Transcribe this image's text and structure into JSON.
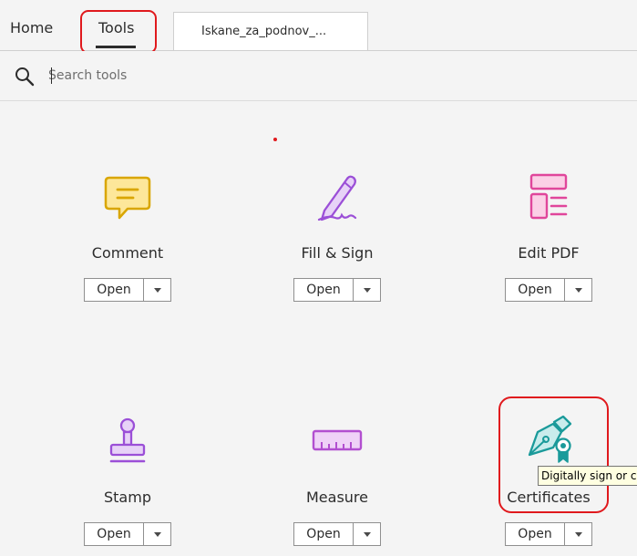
{
  "tabs": {
    "home": "Home",
    "tools": "Tools",
    "document": "Iskane_za_podnov_..."
  },
  "search": {
    "placeholder": "Search tools"
  },
  "tools": [
    {
      "name": "Comment",
      "open": "Open",
      "icon": "comment-icon",
      "color": "#d9a600"
    },
    {
      "name": "Fill & Sign",
      "open": "Open",
      "icon": "fill-sign-icon",
      "color": "#9b4fd7"
    },
    {
      "name": "Edit PDF",
      "open": "Open",
      "icon": "edit-pdf-icon",
      "color": "#e0469b"
    },
    {
      "name": "Stamp",
      "open": "Open",
      "icon": "stamp-icon",
      "color": "#9b4fd7"
    },
    {
      "name": "Measure",
      "open": "Open",
      "icon": "measure-icon",
      "color": "#b24fd0"
    },
    {
      "name": "Certificates",
      "open": "Open",
      "icon": "certificates-icon",
      "color": "#1a9a9a"
    }
  ],
  "tooltip": "Digitally sign or certify",
  "colors": {
    "highlight": "#e0191d",
    "background": "#f4f4f4"
  }
}
